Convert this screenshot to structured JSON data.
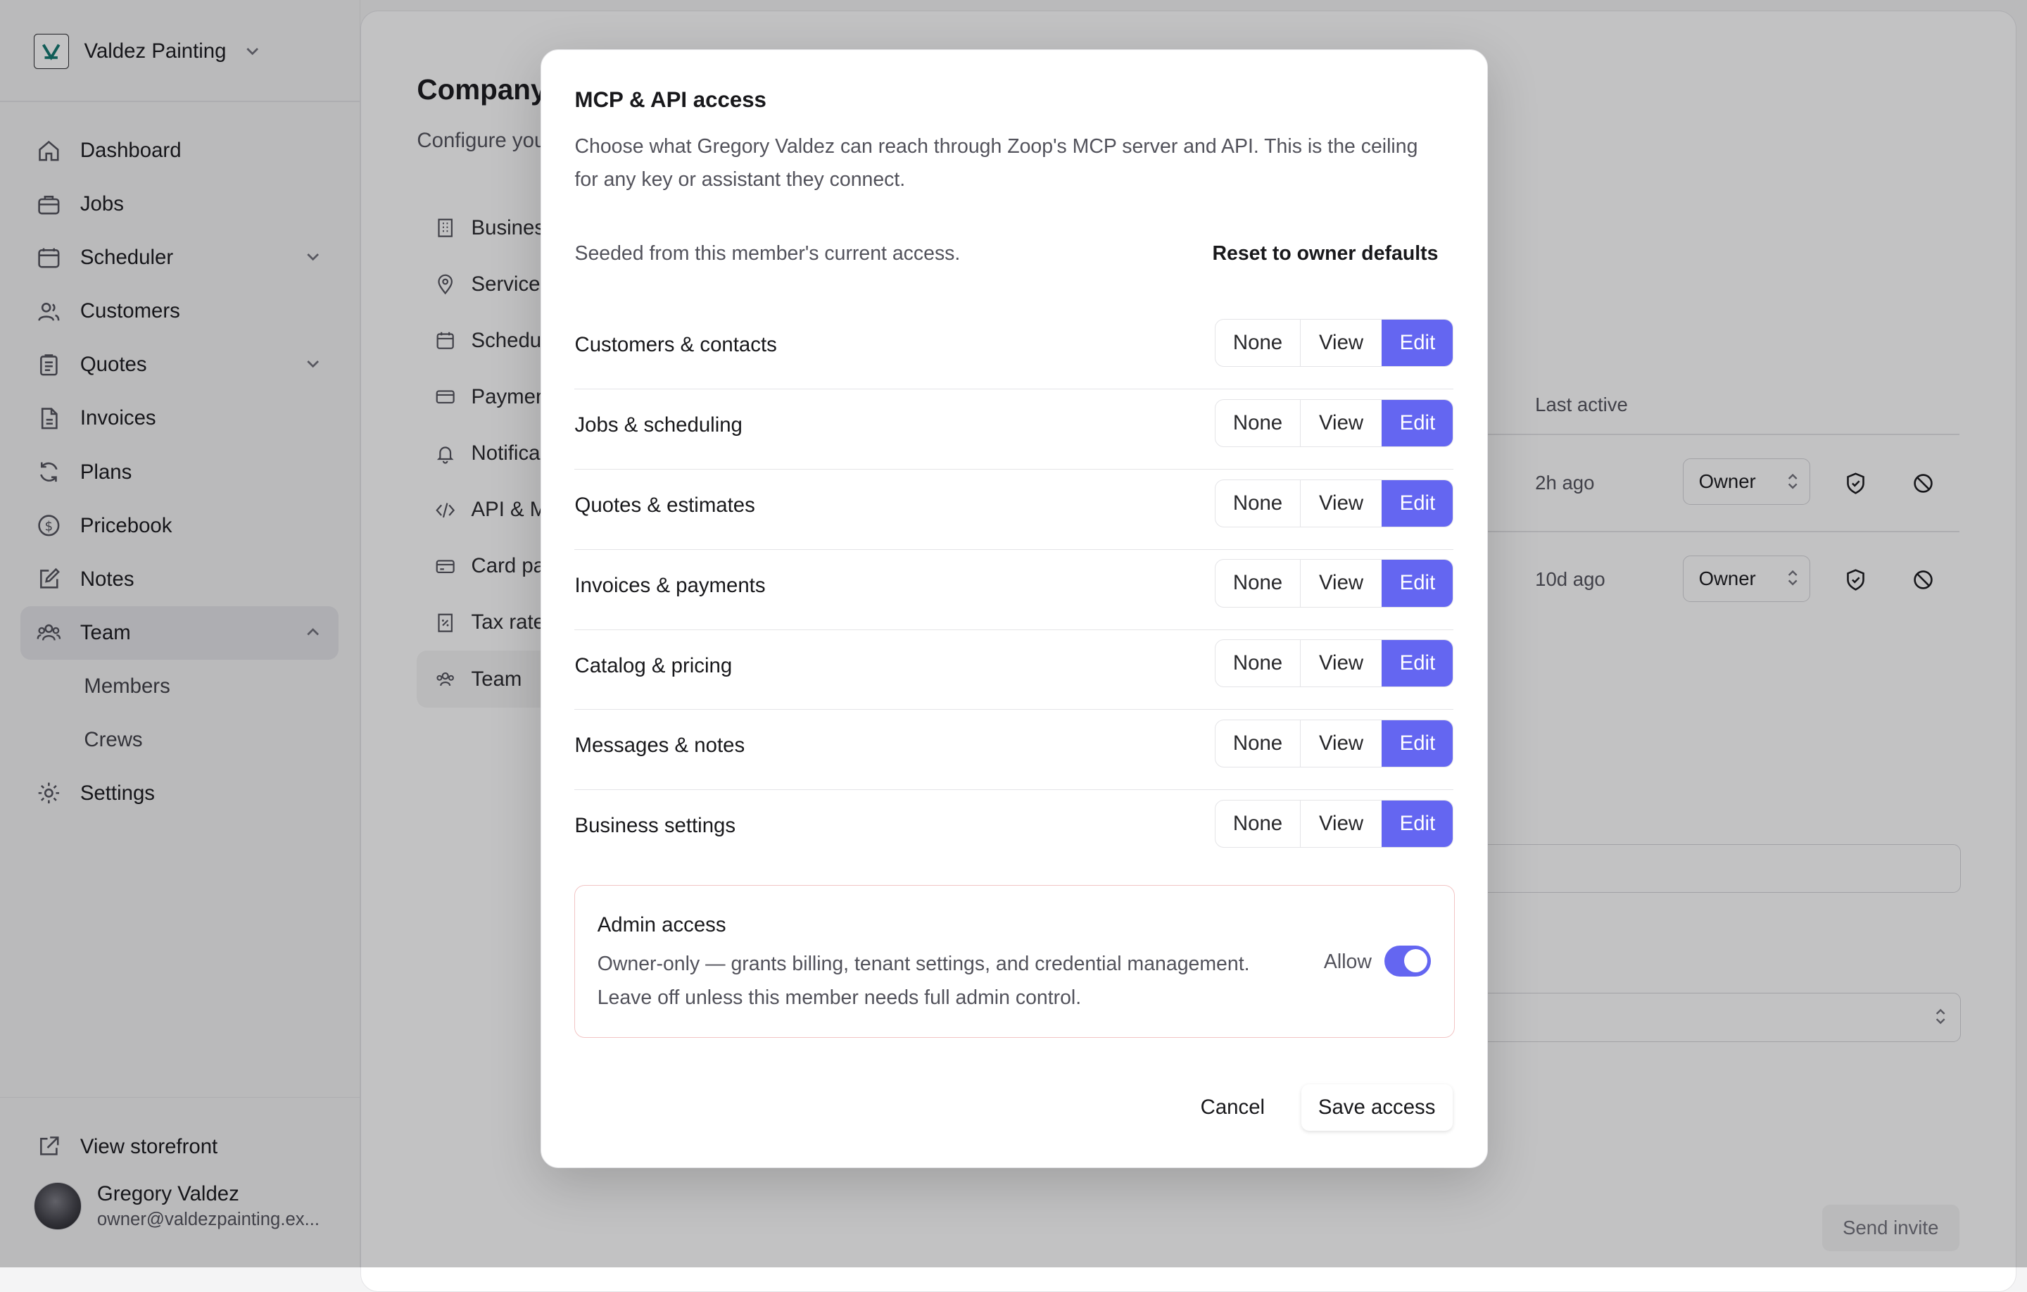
{
  "sidebar": {
    "company": "Valdez Painting",
    "nav": [
      {
        "label": "Dashboard",
        "icon": "home-icon"
      },
      {
        "label": "Jobs",
        "icon": "briefcase-icon"
      },
      {
        "label": "Scheduler",
        "icon": "calendar-icon"
      },
      {
        "label": "Customers",
        "icon": "users-icon"
      },
      {
        "label": "Quotes",
        "icon": "clipboard-icon"
      },
      {
        "label": "Invoices",
        "icon": "file-icon"
      },
      {
        "label": "Plans",
        "icon": "refresh-icon"
      },
      {
        "label": "Pricebook",
        "icon": "dollar-icon"
      },
      {
        "label": "Notes",
        "icon": "pencil-icon"
      },
      {
        "label": "Team",
        "icon": "team-icon"
      },
      {
        "label": "Members"
      },
      {
        "label": "Crews"
      },
      {
        "label": "Settings",
        "icon": "gear-icon"
      }
    ],
    "storefront": "View storefront",
    "user": {
      "name": "Gregory Valdez",
      "email": "owner@valdezpainting.ex..."
    }
  },
  "main": {
    "title": "Company",
    "subtitle": "Configure you",
    "settings_nav": [
      "Busines",
      "Service",
      "Schedu",
      "Paymen",
      "Notifica",
      "API & M",
      "Card pa",
      "Tax rate",
      "Team"
    ],
    "table": {
      "last_active_header": "Last active",
      "rows": [
        {
          "last_active": "2h ago",
          "role": "Owner"
        },
        {
          "last_active": "10d ago",
          "role": "Owner"
        }
      ]
    },
    "send_invite": "Send invite"
  },
  "modal": {
    "title": "MCP & API access",
    "description": "Choose what Gregory Valdez can reach through Zoop's MCP server and API. This is the ceiling for any key or assistant they connect.",
    "seeded_note": "Seeded from this member's current access.",
    "reset_label": "Reset to owner defaults",
    "options": {
      "none": "None",
      "view": "View",
      "edit": "Edit"
    },
    "permissions": [
      {
        "label": "Customers & contacts",
        "selected": "Edit"
      },
      {
        "label": "Jobs & scheduling",
        "selected": "Edit"
      },
      {
        "label": "Quotes & estimates",
        "selected": "Edit"
      },
      {
        "label": "Invoices & payments",
        "selected": "Edit"
      },
      {
        "label": "Catalog & pricing",
        "selected": "Edit"
      },
      {
        "label": "Messages & notes",
        "selected": "Edit"
      },
      {
        "label": "Business settings",
        "selected": "Edit"
      }
    ],
    "admin": {
      "title": "Admin access",
      "description": "Owner-only — grants billing, tenant settings, and credential management. Leave off unless this member needs full admin control.",
      "allow_label": "Allow",
      "enabled": true
    },
    "cancel": "Cancel",
    "save": "Save access"
  },
  "colors": {
    "accent": "#6466f1",
    "admin_border": "#f2c4c4"
  }
}
